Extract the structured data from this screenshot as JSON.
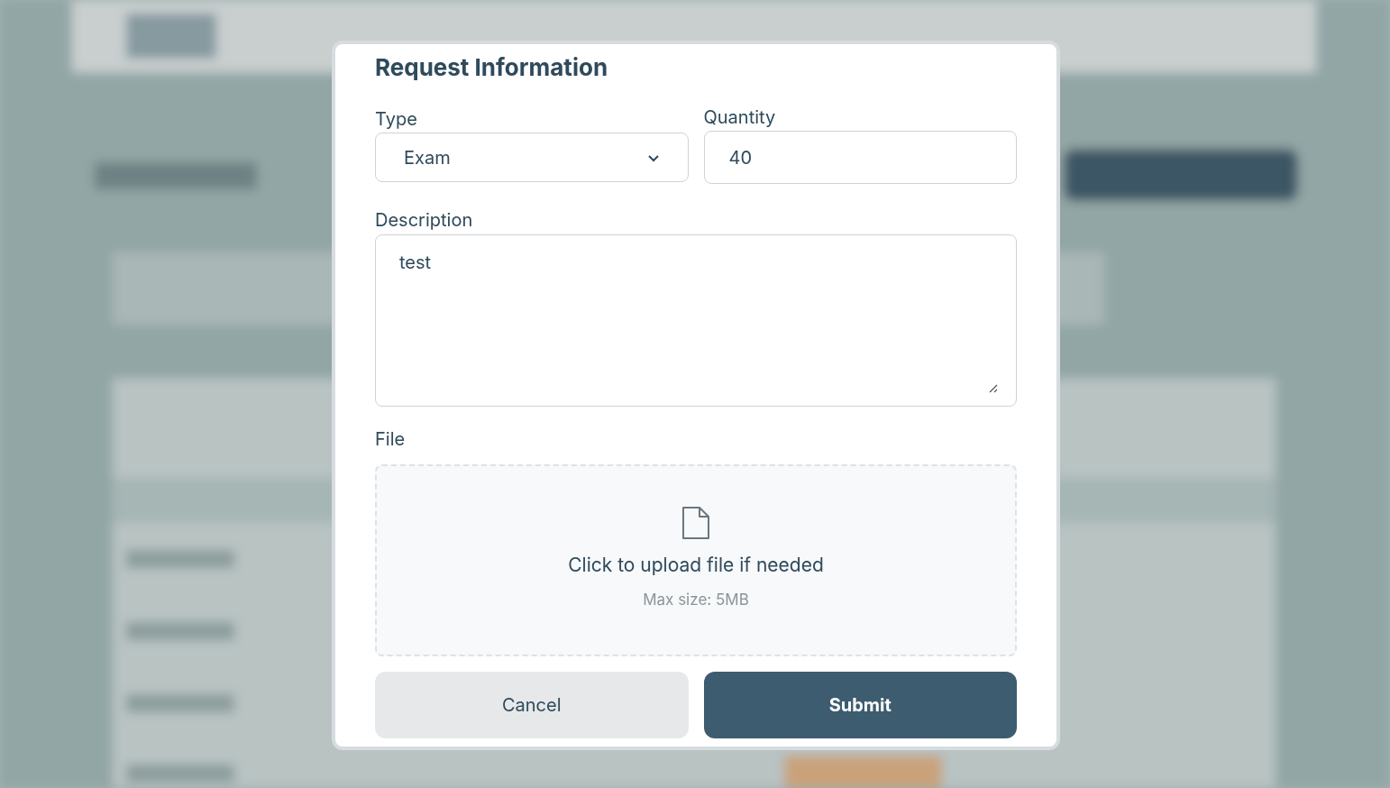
{
  "dialog": {
    "title": "Request Information",
    "fields": [
      {
        "kind": "select",
        "label": "Type",
        "value": "Exam"
      },
      {
        "kind": "input",
        "label": "Quantity",
        "value": "40"
      },
      {
        "kind": "textarea",
        "label": "Description",
        "value": "test"
      },
      {
        "kind": "file",
        "label": "File",
        "prompt": "Click to upload file if needed",
        "hint": "Max size: 5MB"
      }
    ],
    "buttons": [
      {
        "kind": "secondary",
        "label": "Cancel"
      },
      {
        "kind": "primary",
        "label": "Submit"
      }
    ]
  }
}
